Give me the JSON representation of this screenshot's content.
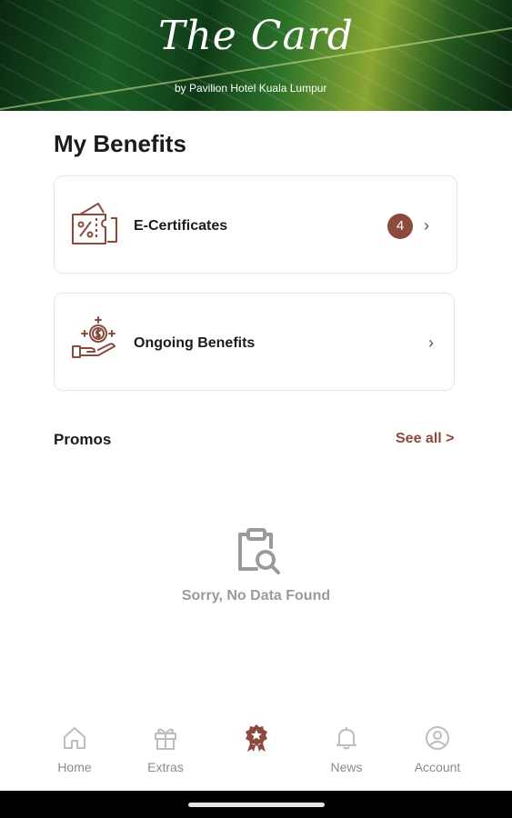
{
  "header": {
    "title": "The Card",
    "subtitle": "by Pavilion Hotel Kuala Lumpur"
  },
  "benefits": {
    "section_title": "My Benefits",
    "items": [
      {
        "label": "E-Certificates",
        "badge": "4",
        "icon": "percent-coupon-icon"
      },
      {
        "label": "Ongoing Benefits",
        "icon": "hand-coin-icon"
      }
    ]
  },
  "promos": {
    "label": "Promos",
    "see_all": "See all >",
    "empty_text": "Sorry, No Data Found",
    "empty_icon": "clipboard-search-icon"
  },
  "nav": {
    "items": [
      {
        "label": "Home",
        "icon": "home-icon"
      },
      {
        "label": "Extras",
        "icon": "gift-icon"
      },
      {
        "label": "",
        "icon": "award-badge-icon",
        "active": true
      },
      {
        "label": "News",
        "icon": "bell-icon"
      },
      {
        "label": "Account",
        "icon": "user-icon"
      }
    ]
  },
  "colors": {
    "accent": "#8b4a3c",
    "muted": "#9a9a9a"
  }
}
